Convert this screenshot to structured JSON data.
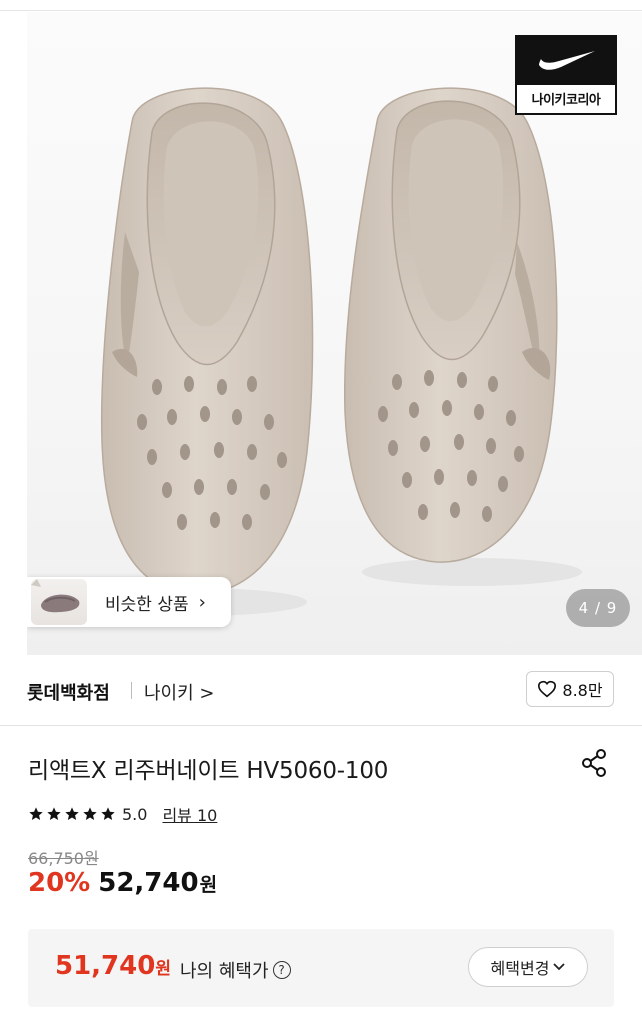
{
  "hero": {
    "brand_badge_label": "나이키코리아",
    "similar_label": "비슷한 상품",
    "similar_chevron": "›",
    "pager": "4 / 9"
  },
  "store": {
    "name": "롯데백화점",
    "brand": "나이키 >",
    "wishlist_count": "8.8만"
  },
  "product": {
    "title": "리액트X 리주버네이트 HV5060-100",
    "rating": "5.0",
    "stars": 5,
    "review_link": "리뷰 10",
    "original_price": "66,750원",
    "discount": "20%",
    "price": "52,740",
    "price_unit": "원"
  },
  "benefit": {
    "price": "51,740",
    "price_unit": "원",
    "label": "나의 혜택가",
    "button": "혜택변경"
  },
  "colors": {
    "accent_red": "#e0361f",
    "shoe_color": "#d9cfc4"
  }
}
